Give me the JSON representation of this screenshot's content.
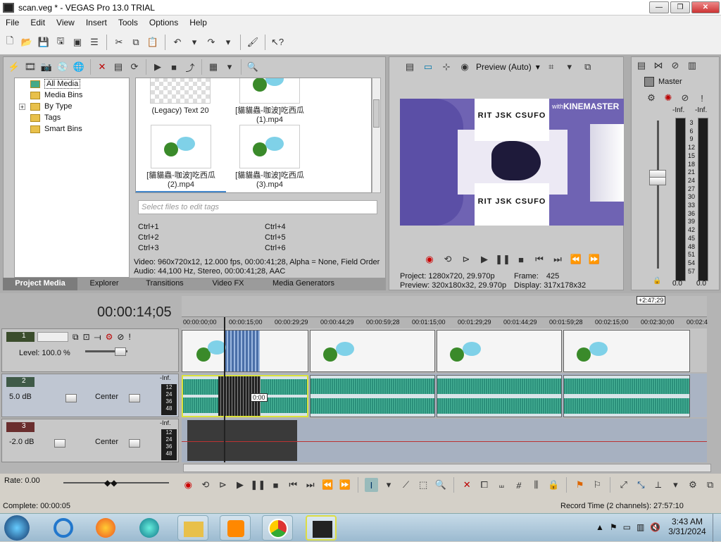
{
  "window": {
    "title": "scan.veg * - VEGAS Pro 13.0 TRIAL",
    "min": "—",
    "max": "❐",
    "close": "✕"
  },
  "menu": [
    "File",
    "Edit",
    "View",
    "Insert",
    "Tools",
    "Options",
    "Help"
  ],
  "project_media": {
    "tree": [
      "All Media",
      "Media Bins",
      "By Type",
      "Tags",
      "Smart Bins"
    ],
    "expand_sign": "+",
    "thumbnails": [
      {
        "label": "(Legacy) Text 20"
      },
      {
        "label": "[貓貓蟲-咖波]吃西瓜 (1).mp4"
      },
      {
        "label": "[貓貓蟲-咖波]吃西瓜 (2).mp4"
      },
      {
        "label": "[貓貓蟲-咖波]吃西瓜 (3).mp4"
      }
    ],
    "tag_placeholder": "Select files to edit tags",
    "hotkeys": [
      "Ctrl+1",
      "Ctrl+4",
      "Ctrl+2",
      "Ctrl+5",
      "Ctrl+3",
      "Ctrl+6"
    ],
    "info_video": "Video: 960x720x12, 12.000 fps, 00:00:41;28, Alpha = None, Field Order",
    "info_audio": "Audio: 44,100 Hz, Stereo, 00:00:41;28, AAC",
    "tabs": [
      "Project Media",
      "Explorer",
      "Transitions",
      "Video FX",
      "Media Generators"
    ]
  },
  "preview": {
    "mode": "Preview (Auto)",
    "frame_text": "KINEMASTER",
    "frame_with": "with",
    "logo_text": "RIT JSK CSUFO",
    "project_label": "Project:",
    "project_value": "1280x720, 29.970p",
    "frame_label": "Frame:",
    "frame_value": "425",
    "preview_label": "Preview:",
    "preview_value": "320x180x32, 29.970p",
    "display_label": "Display:",
    "display_value": "317x178x32"
  },
  "mixer": {
    "name": "Master",
    "left_inf": "-Inf.",
    "right_inf": "-Inf.",
    "scale": [
      "3",
      "6",
      "9",
      "12",
      "15",
      "18",
      "21",
      "24",
      "27",
      "30",
      "33",
      "36",
      "39",
      "42",
      "45",
      "48",
      "51",
      "54",
      "57"
    ],
    "left_val": "0.0",
    "right_val": "0.0"
  },
  "timeline": {
    "timecode": "00:00:14;05",
    "end_marker": "+2:47;29",
    "ruler": [
      "00:00:00;00",
      "00:00:15;00",
      "00:00:29;29",
      "00:00:44;29",
      "00:00:59;28",
      "00:01:15;00",
      "00:01:29;29",
      "00:01:44;29",
      "00:01:59;28",
      "00:02:15;00",
      "00:02:30;00",
      "00:02:4"
    ],
    "tracks": [
      {
        "num": "1",
        "level": "Level: 100.0 %"
      },
      {
        "num": "2",
        "vol": "5.0 dB",
        "pan": "Center",
        "meter": "-Inf."
      },
      {
        "num": "3",
        "vol": "-2.0 dB",
        "pan": "Center",
        "meter": "-Inf."
      }
    ],
    "track_meter_scale": [
      "12",
      "24",
      "36",
      "48"
    ],
    "audio_cursor_text": "0:00",
    "rate": "Rate: 0.00"
  },
  "status": {
    "complete": "Complete: 00:00:05",
    "record": "Record Time (2 channels): 27:57:10"
  },
  "taskbar": {
    "time": "3:43 AM",
    "date": "3/31/2024"
  },
  "colors": {
    "wave": "#2a8f7a",
    "preview_bg": "#6f63b3",
    "taskbar": "#b0c9dc"
  }
}
